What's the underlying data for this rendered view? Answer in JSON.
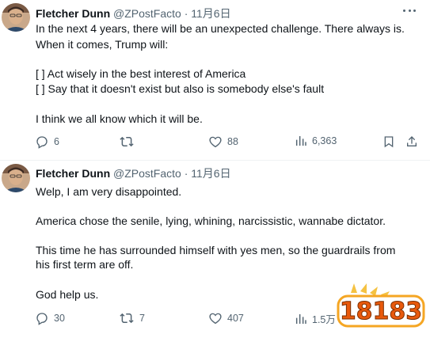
{
  "tweets": [
    {
      "author_name": "Fletcher Dunn",
      "handle": "@ZPostFacto",
      "dot": "·",
      "date": "11月6日",
      "lines": [
        "In the next 4 years, there will be an unexpected challenge.  There always is.",
        " When it comes, Trump will:",
        "[  ] Act wisely in the best interest of America",
        "[  ] Say that it doesn't exist but also is somebody else's fault",
        "I think we all know which it will be."
      ],
      "replies": "6",
      "reposts": "",
      "likes": "88",
      "views": "6,363"
    },
    {
      "author_name": "Fletcher Dunn",
      "handle": "@ZPostFacto",
      "dot": "·",
      "date": "11月6日",
      "lines": [
        "Welp, I am very disappointed.",
        "America chose the senile, lying, whining, narcissistic, wannabe dictator.",
        "This time he has surrounded himself with yes men, so the guardrails from",
        "his first term are off.",
        "God help us."
      ],
      "replies": "30",
      "reposts": "7",
      "likes": "407",
      "views": "1.5万"
    }
  ],
  "watermark": {
    "text": "18183"
  },
  "colors": {
    "text": "#0f1419",
    "muted": "#536471",
    "divider": "#eff3f4",
    "watermark": "#f5a623"
  },
  "icons": [
    "avatar-photo",
    "more-icon",
    "reply-icon",
    "repost-icon",
    "like-icon",
    "views-icon",
    "bookmark-icon",
    "share-icon"
  ]
}
